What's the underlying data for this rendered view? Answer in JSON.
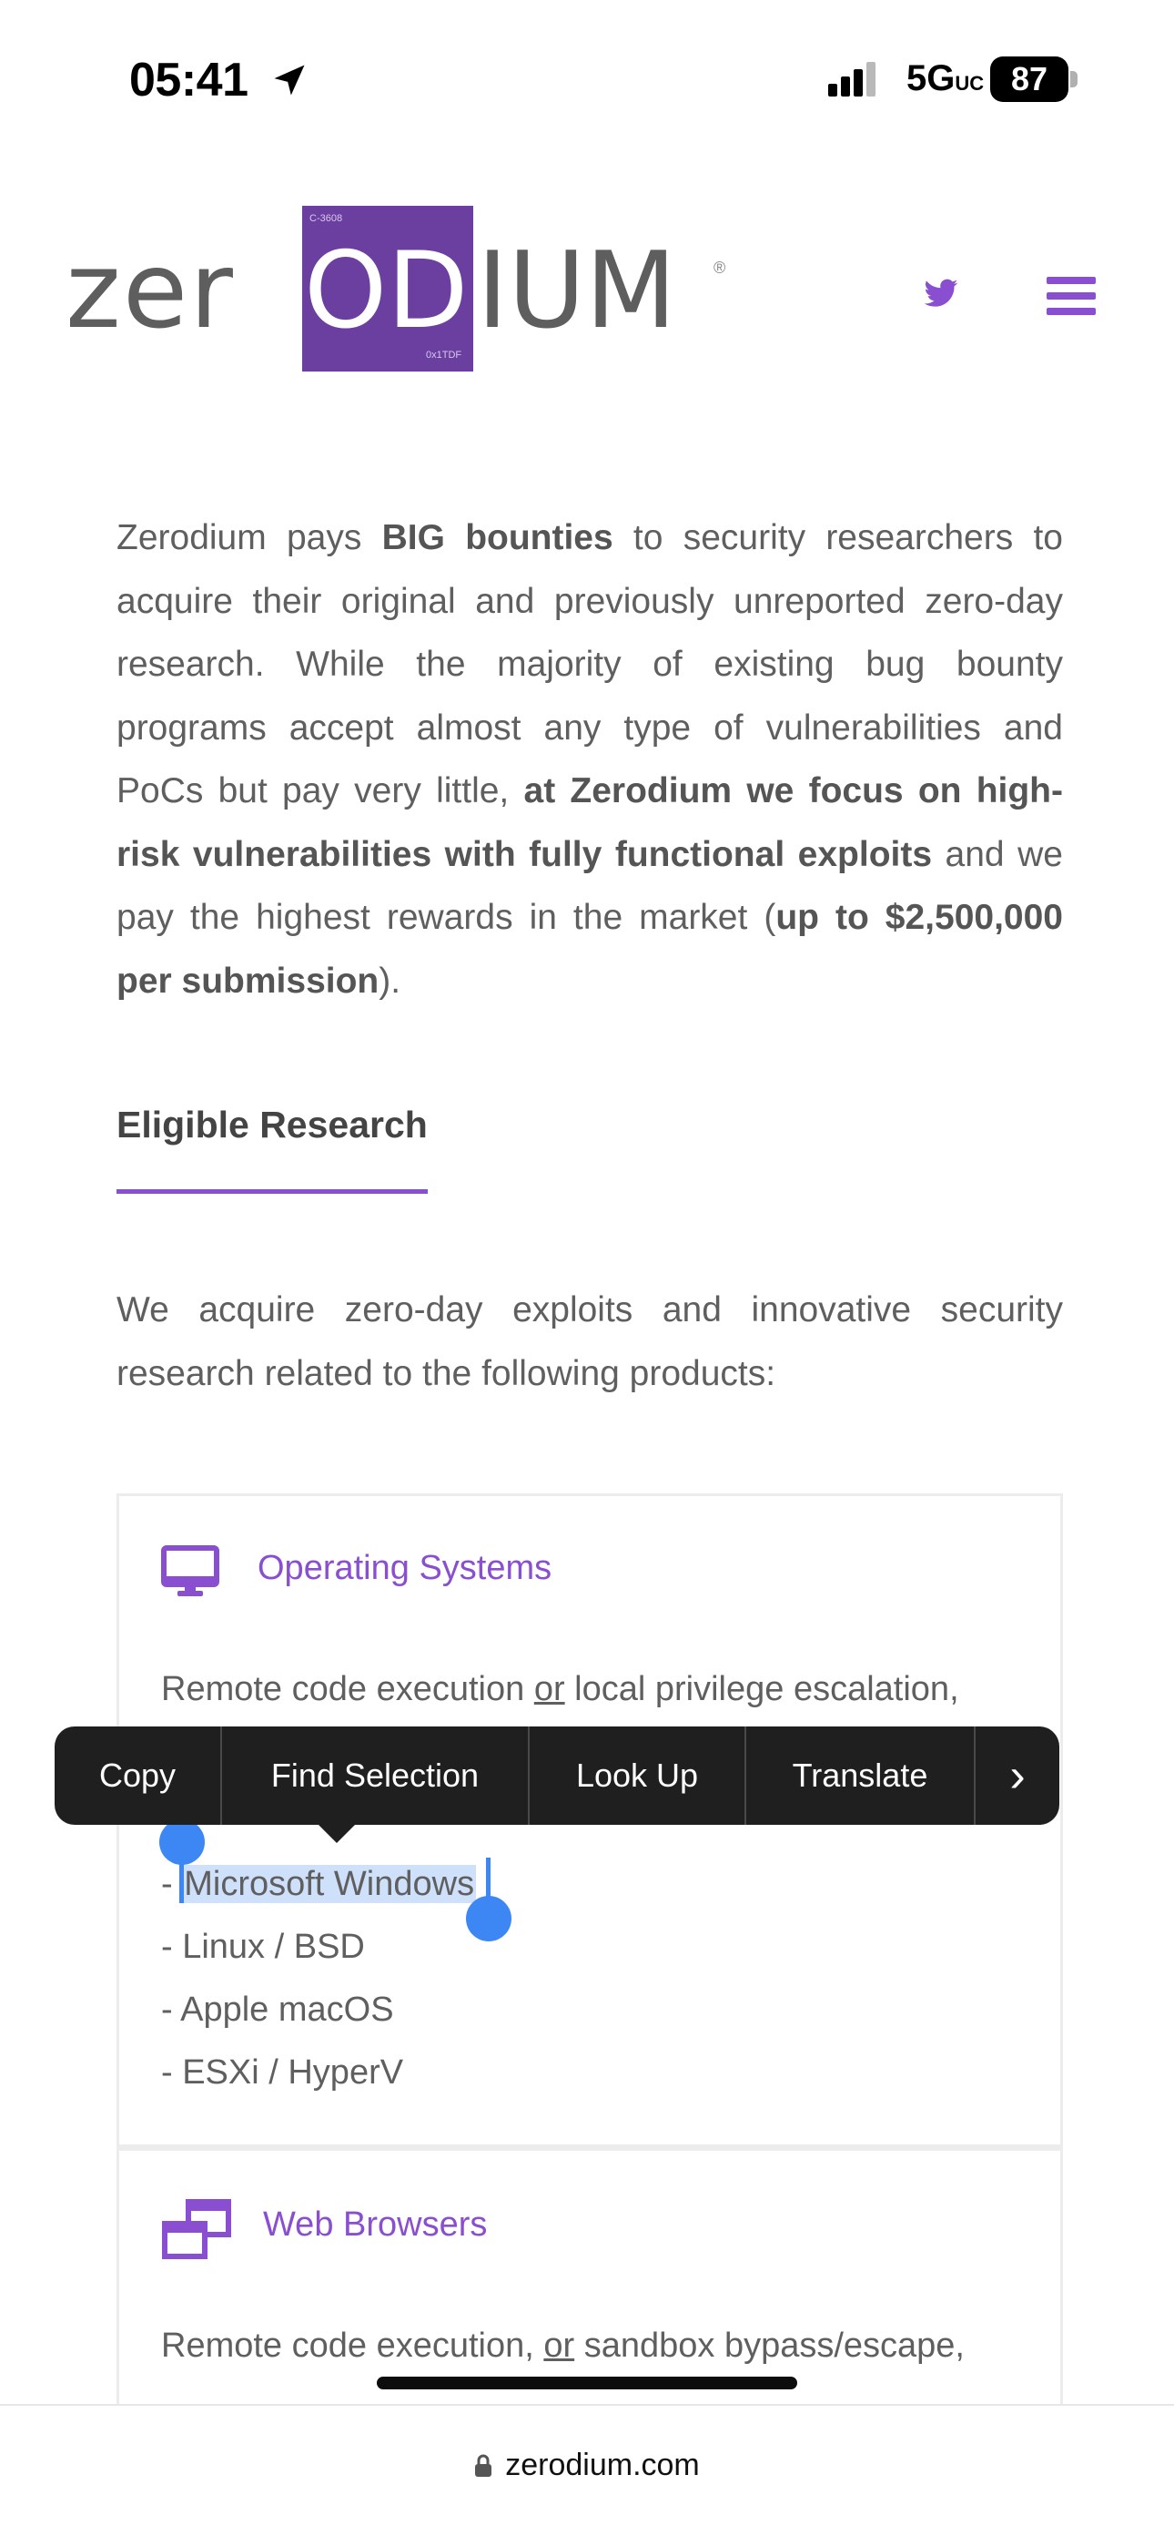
{
  "status_bar": {
    "time": "05:41",
    "network": "5G",
    "network_suffix": "UC",
    "battery": "87"
  },
  "header": {
    "logo": {
      "left": "zer",
      "mid": "OD",
      "right": "IUM",
      "small_top": "C-3608",
      "small_bottom": "0x1TDF",
      "brand_color": "#6b3fa0"
    },
    "icons": [
      "twitter-icon",
      "hamburger-menu-icon"
    ]
  },
  "intro": {
    "p1": "Zerodium pays ",
    "b1": "BIG bounties",
    "p2": " to security researchers to acquire their original and previously unreported zero-day research. While the majority of existing bug bounty programs accept almost any type of vulnerabilities and PoCs but pay very little, ",
    "b2": "at Zerodium we focus on high-risk vulnerabilities with fully functional exploits",
    "p3": " and we pay the highest rewards in the market (",
    "b3": "up to $2,500,000 per submission",
    "p4": ")."
  },
  "eligible": {
    "title": "Eligible Research",
    "lead": "We acquire zero-day exploits and innovative security research related to the following products:"
  },
  "cards": {
    "os": {
      "title": "Operating Systems",
      "desc_pre": "Remote code execution ",
      "desc_or": "or",
      "desc_post": " local privilege escalation,",
      "items": [
        "- ",
        "Microsoft Windows",
        "- Linux / BSD",
        "- Apple macOS",
        "- ESXi / HyperV"
      ]
    },
    "web": {
      "title": "Web Browsers",
      "desc_pre": "Remote code execution, ",
      "desc_or": "or",
      "desc_post": " sandbox bypass/escape,"
    }
  },
  "context_menu": {
    "items": [
      "Copy",
      "Find Selection",
      "Look Up",
      "Translate"
    ],
    "more": "›"
  },
  "browser": {
    "url": "zerodium.com"
  },
  "colors": {
    "accent": "#8a4fd0",
    "selection": "#3d87f5"
  }
}
